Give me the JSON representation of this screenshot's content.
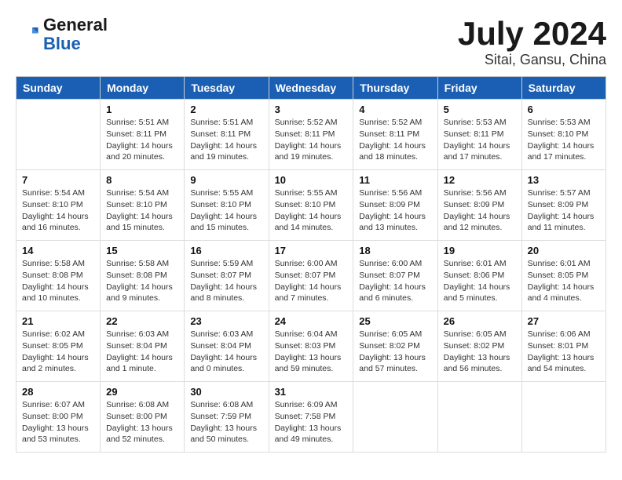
{
  "header": {
    "logo_line1": "General",
    "logo_line2": "Blue",
    "month_year": "July 2024",
    "location": "Sitai, Gansu, China"
  },
  "weekdays": [
    "Sunday",
    "Monday",
    "Tuesday",
    "Wednesday",
    "Thursday",
    "Friday",
    "Saturday"
  ],
  "weeks": [
    [
      {
        "day": "",
        "info": ""
      },
      {
        "day": "1",
        "info": "Sunrise: 5:51 AM\nSunset: 8:11 PM\nDaylight: 14 hours\nand 20 minutes."
      },
      {
        "day": "2",
        "info": "Sunrise: 5:51 AM\nSunset: 8:11 PM\nDaylight: 14 hours\nand 19 minutes."
      },
      {
        "day": "3",
        "info": "Sunrise: 5:52 AM\nSunset: 8:11 PM\nDaylight: 14 hours\nand 19 minutes."
      },
      {
        "day": "4",
        "info": "Sunrise: 5:52 AM\nSunset: 8:11 PM\nDaylight: 14 hours\nand 18 minutes."
      },
      {
        "day": "5",
        "info": "Sunrise: 5:53 AM\nSunset: 8:11 PM\nDaylight: 14 hours\nand 17 minutes."
      },
      {
        "day": "6",
        "info": "Sunrise: 5:53 AM\nSunset: 8:10 PM\nDaylight: 14 hours\nand 17 minutes."
      }
    ],
    [
      {
        "day": "7",
        "info": "Sunrise: 5:54 AM\nSunset: 8:10 PM\nDaylight: 14 hours\nand 16 minutes."
      },
      {
        "day": "8",
        "info": "Sunrise: 5:54 AM\nSunset: 8:10 PM\nDaylight: 14 hours\nand 15 minutes."
      },
      {
        "day": "9",
        "info": "Sunrise: 5:55 AM\nSunset: 8:10 PM\nDaylight: 14 hours\nand 15 minutes."
      },
      {
        "day": "10",
        "info": "Sunrise: 5:55 AM\nSunset: 8:10 PM\nDaylight: 14 hours\nand 14 minutes."
      },
      {
        "day": "11",
        "info": "Sunrise: 5:56 AM\nSunset: 8:09 PM\nDaylight: 14 hours\nand 13 minutes."
      },
      {
        "day": "12",
        "info": "Sunrise: 5:56 AM\nSunset: 8:09 PM\nDaylight: 14 hours\nand 12 minutes."
      },
      {
        "day": "13",
        "info": "Sunrise: 5:57 AM\nSunset: 8:09 PM\nDaylight: 14 hours\nand 11 minutes."
      }
    ],
    [
      {
        "day": "14",
        "info": "Sunrise: 5:58 AM\nSunset: 8:08 PM\nDaylight: 14 hours\nand 10 minutes."
      },
      {
        "day": "15",
        "info": "Sunrise: 5:58 AM\nSunset: 8:08 PM\nDaylight: 14 hours\nand 9 minutes."
      },
      {
        "day": "16",
        "info": "Sunrise: 5:59 AM\nSunset: 8:07 PM\nDaylight: 14 hours\nand 8 minutes."
      },
      {
        "day": "17",
        "info": "Sunrise: 6:00 AM\nSunset: 8:07 PM\nDaylight: 14 hours\nand 7 minutes."
      },
      {
        "day": "18",
        "info": "Sunrise: 6:00 AM\nSunset: 8:07 PM\nDaylight: 14 hours\nand 6 minutes."
      },
      {
        "day": "19",
        "info": "Sunrise: 6:01 AM\nSunset: 8:06 PM\nDaylight: 14 hours\nand 5 minutes."
      },
      {
        "day": "20",
        "info": "Sunrise: 6:01 AM\nSunset: 8:05 PM\nDaylight: 14 hours\nand 4 minutes."
      }
    ],
    [
      {
        "day": "21",
        "info": "Sunrise: 6:02 AM\nSunset: 8:05 PM\nDaylight: 14 hours\nand 2 minutes."
      },
      {
        "day": "22",
        "info": "Sunrise: 6:03 AM\nSunset: 8:04 PM\nDaylight: 14 hours\nand 1 minute."
      },
      {
        "day": "23",
        "info": "Sunrise: 6:03 AM\nSunset: 8:04 PM\nDaylight: 14 hours\nand 0 minutes."
      },
      {
        "day": "24",
        "info": "Sunrise: 6:04 AM\nSunset: 8:03 PM\nDaylight: 13 hours\nand 59 minutes."
      },
      {
        "day": "25",
        "info": "Sunrise: 6:05 AM\nSunset: 8:02 PM\nDaylight: 13 hours\nand 57 minutes."
      },
      {
        "day": "26",
        "info": "Sunrise: 6:05 AM\nSunset: 8:02 PM\nDaylight: 13 hours\nand 56 minutes."
      },
      {
        "day": "27",
        "info": "Sunrise: 6:06 AM\nSunset: 8:01 PM\nDaylight: 13 hours\nand 54 minutes."
      }
    ],
    [
      {
        "day": "28",
        "info": "Sunrise: 6:07 AM\nSunset: 8:00 PM\nDaylight: 13 hours\nand 53 minutes."
      },
      {
        "day": "29",
        "info": "Sunrise: 6:08 AM\nSunset: 8:00 PM\nDaylight: 13 hours\nand 52 minutes."
      },
      {
        "day": "30",
        "info": "Sunrise: 6:08 AM\nSunset: 7:59 PM\nDaylight: 13 hours\nand 50 minutes."
      },
      {
        "day": "31",
        "info": "Sunrise: 6:09 AM\nSunset: 7:58 PM\nDaylight: 13 hours\nand 49 minutes."
      },
      {
        "day": "",
        "info": ""
      },
      {
        "day": "",
        "info": ""
      },
      {
        "day": "",
        "info": ""
      }
    ]
  ]
}
